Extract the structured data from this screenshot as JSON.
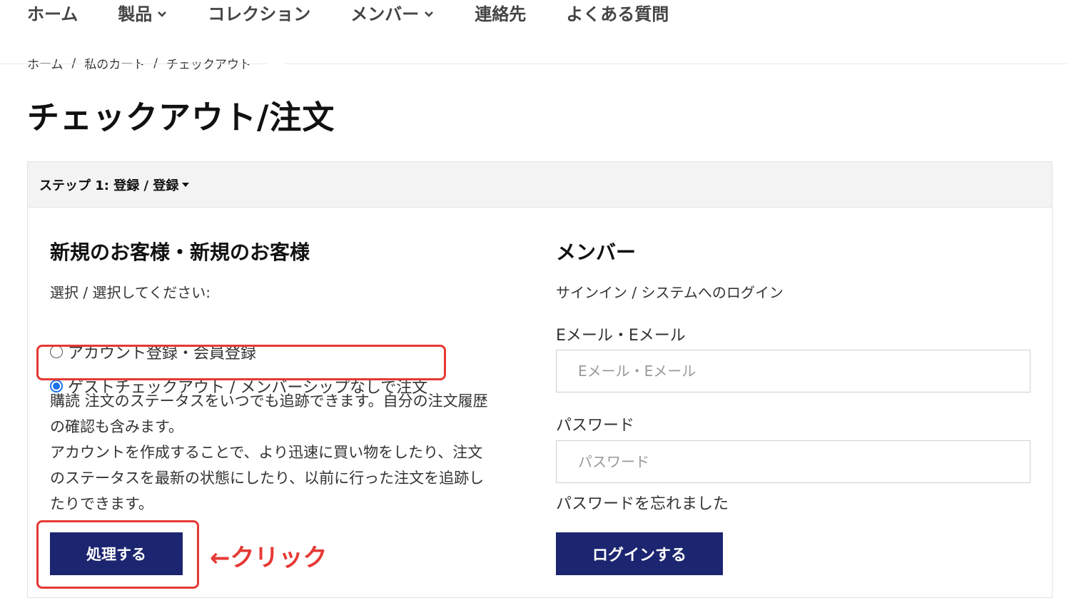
{
  "nav": {
    "items": [
      {
        "label": "ホーム",
        "dropdown": false
      },
      {
        "label": "製品",
        "dropdown": true
      },
      {
        "label": "コレクション",
        "dropdown": false
      },
      {
        "label": "メンバー",
        "dropdown": true
      },
      {
        "label": "連絡先",
        "dropdown": false
      },
      {
        "label": "よくある質問",
        "dropdown": false
      }
    ]
  },
  "breadcrumb": {
    "items": [
      "ホーム",
      "私のカート",
      "チェックアウト"
    ],
    "separator": "/"
  },
  "page_title": "チェックアウト/注文",
  "step": {
    "label": "ステップ 1: 登録 / 登録"
  },
  "new_customer": {
    "heading": "新規のお客様・新規のお客様",
    "prompt": "選択 / 選択してください:",
    "options": [
      {
        "label": "アカウント登録・会員登録",
        "checked": false
      },
      {
        "label": "ゲストチェックアウト / メンバーシップなしで注文",
        "checked": true
      }
    ],
    "description_lines": [
      "購読 注文のステータスをいつでも追跡できます。自分の注文履歴",
      "の確認も含みます。",
      "アカウントを作成することで、より迅速に買い物をしたり、注文",
      "のステータスを最新の状態にしたり、以前に行った注文を追跡し",
      "たりできます。"
    ],
    "process_button": "処理する"
  },
  "member": {
    "heading": "メンバー",
    "subtitle": "サインイン / システムへのログイン",
    "email_label": "Eメール・Eメール",
    "email_placeholder": "Eメール・Eメール",
    "password_label": "パスワード",
    "password_placeholder": "パスワード",
    "forgot_password": "パスワードを忘れました",
    "login_button": "ログインする"
  },
  "annotation": {
    "click_text": "←クリック",
    "color": "#e53935"
  },
  "colors": {
    "button_bg": "#1c2570",
    "radio_accent": "#1a73e8",
    "header_bg": "#f3f3f3"
  }
}
